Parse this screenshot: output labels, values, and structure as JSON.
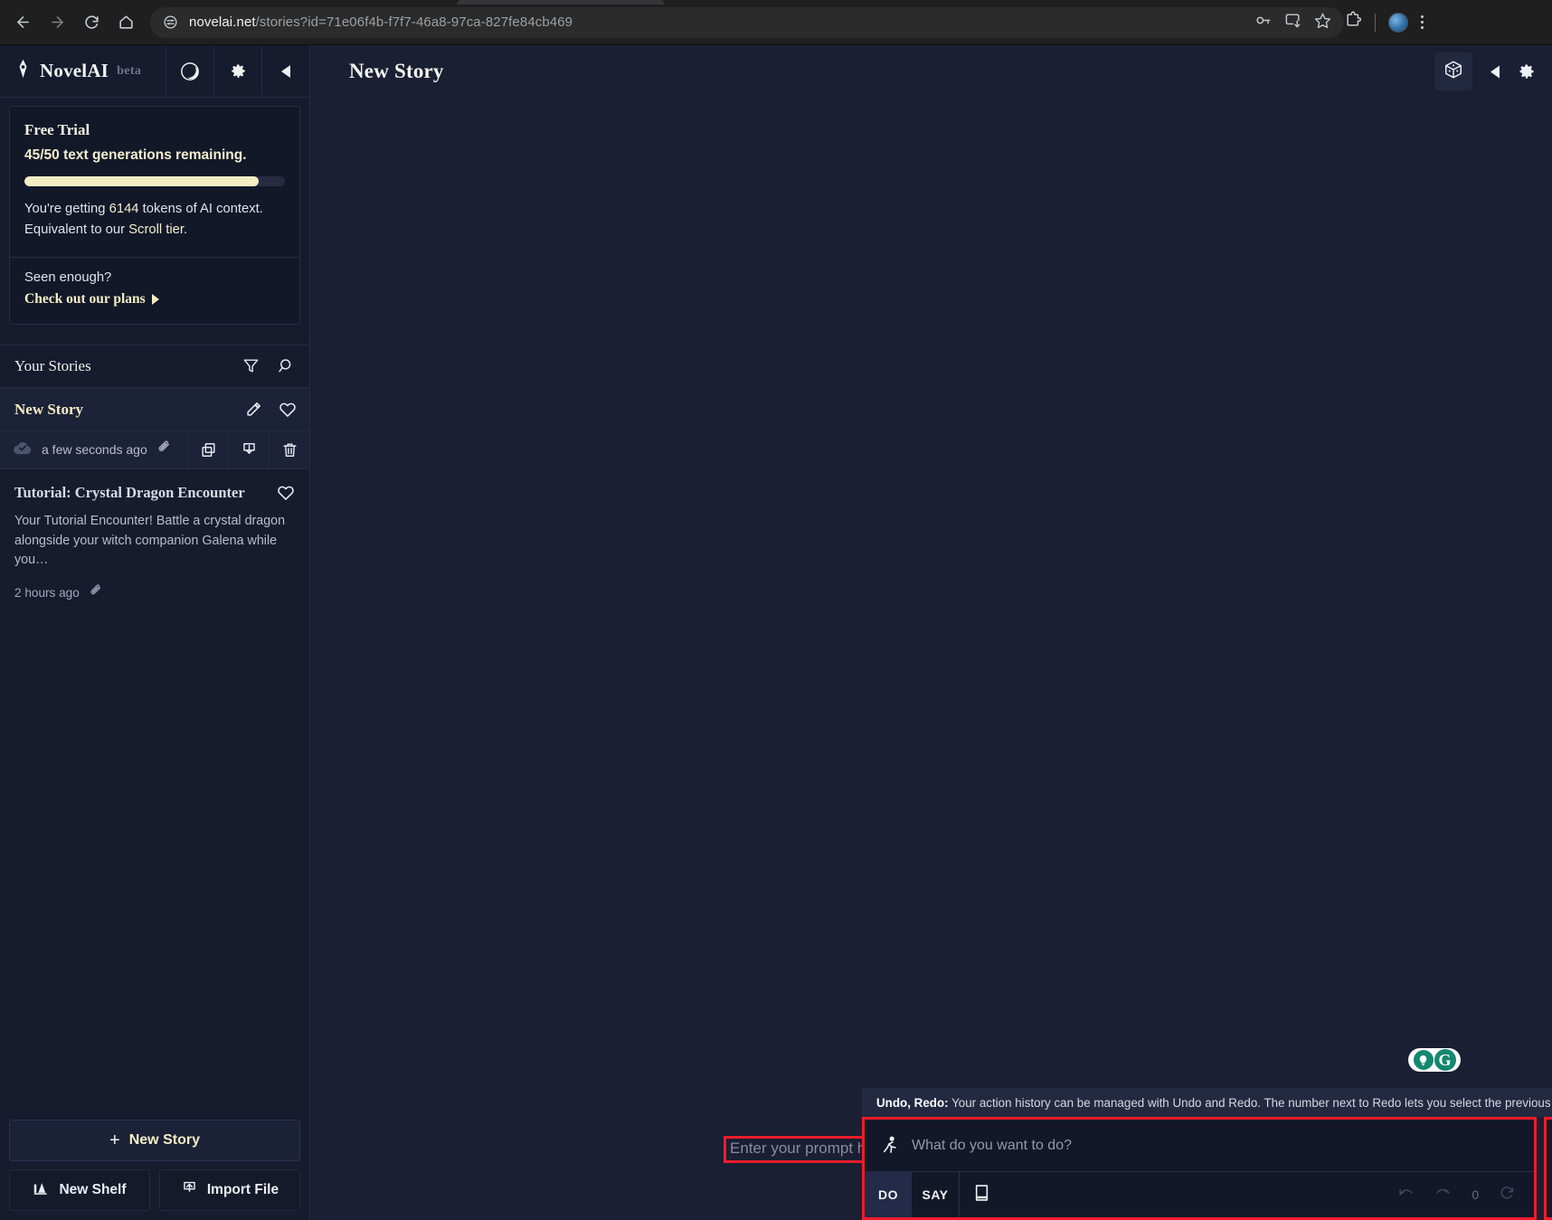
{
  "browser": {
    "url_host": "novelai.net",
    "url_path": "/stories?id=71e06f4b-f7f7-46a8-97ca-827fe84cb469",
    "icons": {
      "back": "back-arrow-icon",
      "forward": "forward-arrow-icon",
      "reload": "reload-icon",
      "home": "home-icon",
      "site_info": "site-settings-icon",
      "password": "key-icon",
      "install": "install-app-icon",
      "bookmark": "star-icon",
      "extensions": "extensions-puzzle-icon",
      "profile": "profile-avatar-icon",
      "menu": "three-dot-menu-icon"
    }
  },
  "sidebar": {
    "brand": {
      "name": "NovelAI",
      "tag": "beta"
    },
    "header_buttons": [
      {
        "name": "theme-moon-button",
        "icon": "moon-icon"
      },
      {
        "name": "settings-button",
        "icon": "gear-icon"
      },
      {
        "name": "collapse-sidebar-button",
        "icon": "chevron-left-icon"
      }
    ],
    "trial": {
      "title": "Free Trial",
      "generations": "45/50 text generations remaining.",
      "progress_percent": 90,
      "note_prefix": "You're getting ",
      "note_tokens": "6144",
      "note_middle": " tokens of AI context.",
      "note_line2_prefix": "Equivalent to our ",
      "note_tier": "Scroll tier",
      "note_line2_suffix": ".",
      "seen_enough": "Seen enough?",
      "plans_link": "Check out our plans"
    },
    "stories_header": {
      "title": "Your Stories",
      "filter_icon": "filter-funnel-icon",
      "search_icon": "search-icon"
    },
    "stories": [
      {
        "title": "New Story",
        "selected": true,
        "timestamp": "a few seconds ago",
        "status_icon": "cloud-saved-icon",
        "attachment_icon": "paperclip-icon",
        "actions": [
          "edit-pencil-icon",
          "heart-icon",
          "duplicate-icon",
          "download-icon",
          "trash-icon"
        ]
      },
      {
        "title": "Tutorial: Crystal Dragon Encounter",
        "selected": false,
        "description": "Your Tutorial Encounter! Battle a crystal dragon alongside your witch companion Galena while you…",
        "timestamp": "2 hours ago",
        "attachment_icon": "paperclip-icon",
        "actions": [
          "heart-icon"
        ]
      }
    ],
    "footer": {
      "new_story": "New Story",
      "new_shelf": "New Shelf",
      "import_file": "Import File"
    }
  },
  "main": {
    "title": "New Story",
    "header_buttons": [
      {
        "name": "randomize-dice-button",
        "icon": "dice-cube-icon"
      },
      {
        "name": "collapse-right-panel-button",
        "icon": "triangle-left-icon"
      },
      {
        "name": "story-settings-button",
        "icon": "gear-icon"
      }
    ],
    "prompt_placeholder": "Enter your prompt here…",
    "grammarly": {
      "bulb": "lightbulb-icon",
      "logo": "G"
    }
  },
  "dock": {
    "tip_label": "Undo, Redo:",
    "tip_text": " Your action history can be managed with Undo and Redo. The number next to Redo lets you select the previous AI…",
    "tip_close": "✕",
    "input_placeholder": "What do you want to do?",
    "run_icon": "running-person-icon",
    "mode_do": "DO",
    "mode_say": "SAY",
    "lorebook_icon": "book-icon",
    "undo_icon": "undo-arrow-icon",
    "redo_icon": "redo-arrow-icon",
    "redo_count": "0",
    "retry_icon": "retry-icon",
    "send_label": "❯"
  },
  "colors": {
    "accent_cream": "#f4edc3",
    "page_bg": "#1a1f33",
    "sidebar_bg": "#161b2e",
    "highlight_red": "#f01b2b",
    "grammarly_teal": "#15876f"
  }
}
